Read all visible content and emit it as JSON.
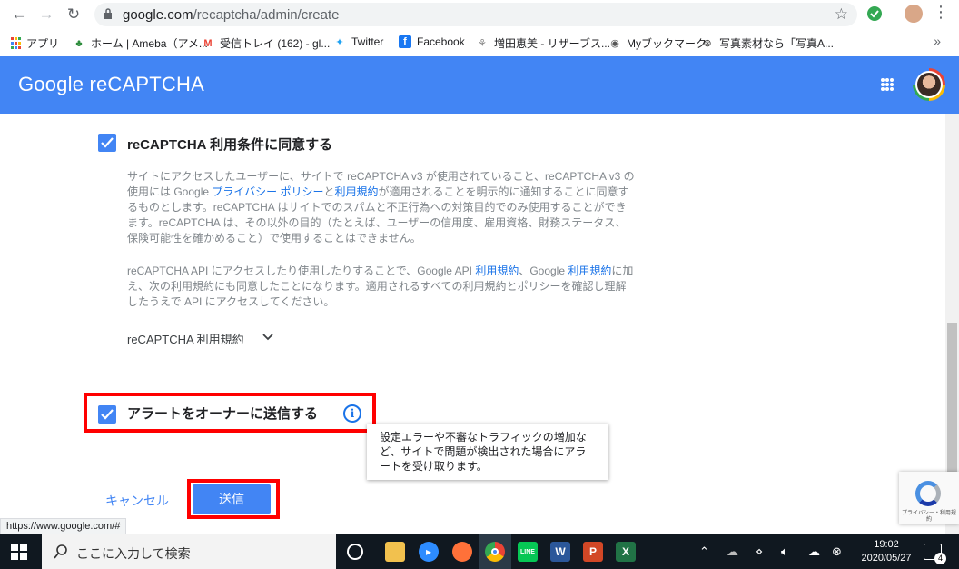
{
  "browser": {
    "url_host": "google.com",
    "url_path": "/recaptcha/admin/create",
    "bookmarks": [
      {
        "label": "アプリ",
        "icon": "apps-icon"
      },
      {
        "label": "ホーム | Ameba（アメ...",
        "icon": "ameba-icon"
      },
      {
        "label": "受信トレイ (162) - gl...",
        "icon": "gmail-icon"
      },
      {
        "label": "Twitter",
        "icon": "twitter-icon"
      },
      {
        "label": "Facebook",
        "icon": "facebook-icon"
      },
      {
        "label": "増田恵美 - リザーブス...",
        "icon": "reserve-icon"
      },
      {
        "label": "Myブックマーク",
        "icon": "globe-icon"
      },
      {
        "label": "写真素材なら「写真A...",
        "icon": "photo-icon"
      }
    ],
    "more_bookmarks": "»"
  },
  "header": {
    "title": "Google reCAPTCHA"
  },
  "form": {
    "terms_label": "reCAPTCHA 利用条件に同意する",
    "para1": {
      "t1": "サイトにアクセスしたユーザーに、サイトで reCAPTCHA v3 が使用されていること、reCAPTCHA v3 の使用には Google ",
      "link1": "プライバシー ポリシー",
      "t2": "と",
      "link2": "利用規約",
      "t3": "が適用されることを明示的に通知することに同意するものとします。reCAPTCHA はサイトでのスパムと不正行為への対策目的でのみ使用することができます。reCAPTCHA は、その以外の目的（たとえば、ユーザーの信用度、雇用資格、財務ステータス、保険可能性を確かめること）で使用することはできません。"
    },
    "para2": {
      "t1": "reCAPTCHA API にアクセスしたり使用したりすることで、Google API ",
      "link1": "利用規約",
      "t2": "、Google ",
      "link2": "利用規約",
      "t3": "に加え、次の利用規約にも同意したことになります。適用されるすべての利用規約とポリシーを確認し理解したうえで API にアクセスしてください。"
    },
    "terms_toggle": "reCAPTCHA 利用規約",
    "alert_label": "アラートをオーナーに送信する",
    "tooltip": "設定エラーや不審なトラフィックの増加など、サイトで問題が検出された場合にアラートを受け取ります。",
    "cancel": "キャンセル",
    "submit": "送信"
  },
  "recaptcha_badge": "プライバシー・利用規約",
  "status_url": "https://www.google.com/#",
  "taskbar": {
    "search_placeholder": "ここに入力して検索",
    "time": "19:02",
    "date": "2020/05/27",
    "notifications": "4"
  },
  "colors": {
    "accent": "#4285f4",
    "highlight": "#ff0000",
    "taskbar": "#101820"
  }
}
